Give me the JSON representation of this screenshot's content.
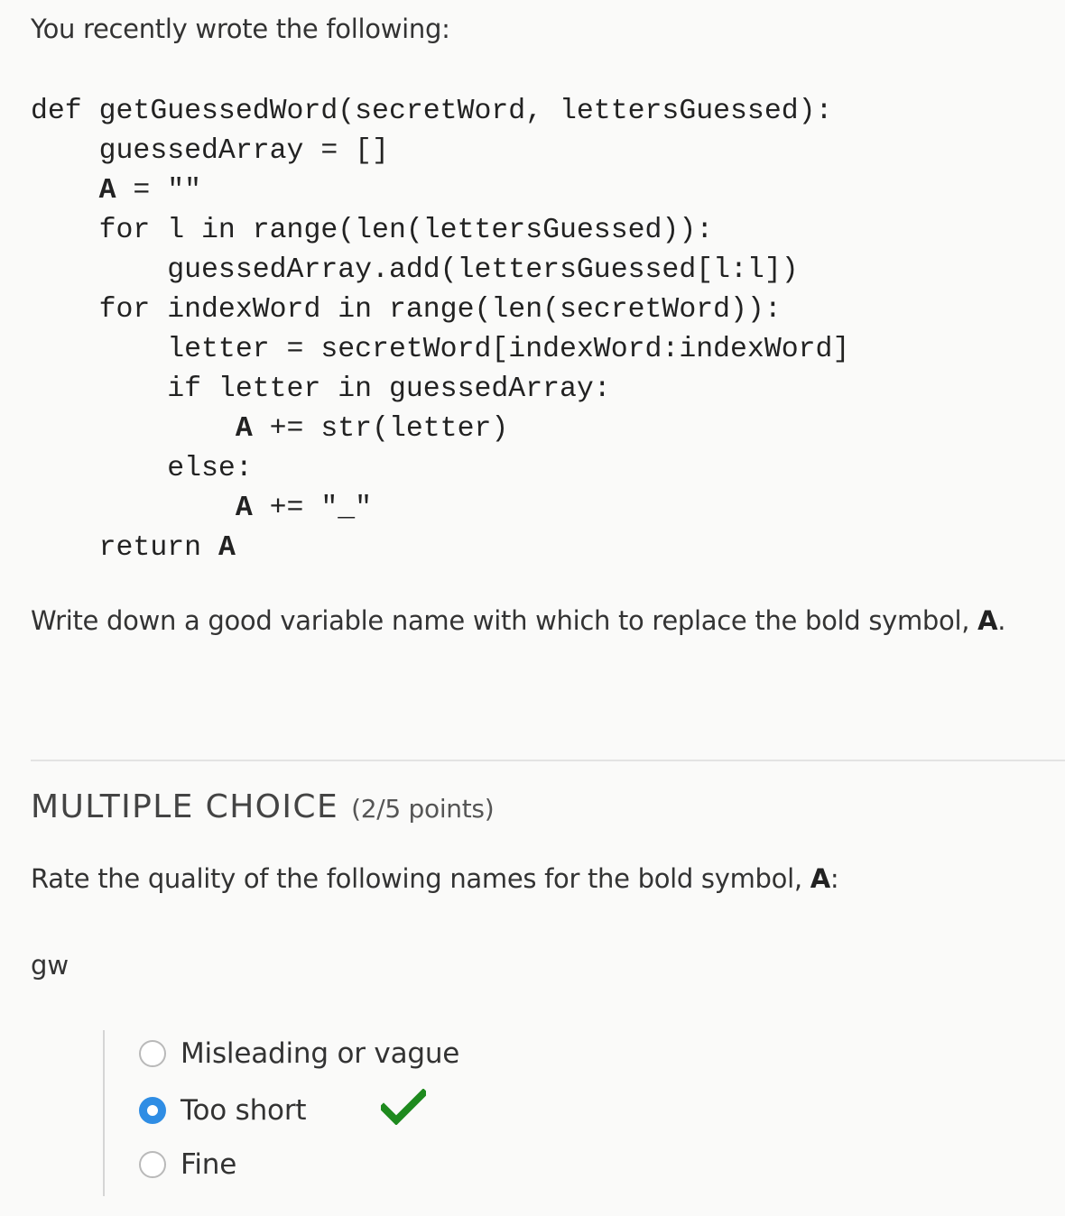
{
  "intro_text": "You recently wrote the following:",
  "code": {
    "line1": "def getGuessedWord(secretWord, lettersGuessed):",
    "line2": "    guessedArray = []",
    "line3_sym": "A",
    "line3_rest": " = \"\"",
    "line4": "    for l in range(len(lettersGuessed)):",
    "line5": "        guessedArray.add(lettersGuessed[l:l])",
    "line6": "    for indexWord in range(len(secretWord)):",
    "line7": "        letter = secretWord[indexWord:indexWord]",
    "line8": "        if letter in guessedArray:",
    "line9_sym": "A",
    "line9_rest": " += str(letter)",
    "line10": "        else:",
    "line11_sym": "A",
    "line11_rest": " += \"_\"",
    "line12_kw": "return ",
    "line12_sym": "A"
  },
  "prompt": {
    "text": "Write down a good variable name with which to replace the bold symbol, ",
    "symbol": "A",
    "end": "."
  },
  "section": {
    "title": "MULTIPLE CHOICE",
    "points": "(2/5 points)"
  },
  "rate": {
    "text": "Rate the quality of the following names for the bold symbol, ",
    "symbol": "A",
    "end": ":"
  },
  "candidate_name": "gw",
  "options": [
    {
      "label": "Misleading or vague",
      "selected": false
    },
    {
      "label": "Too short",
      "selected": true,
      "correct": true
    },
    {
      "label": "Fine",
      "selected": false
    }
  ],
  "colors": {
    "radio_selected": "#2f8de4",
    "correct_check": "#1e8a1e"
  },
  "icons": {
    "correct": "checkmark-icon"
  }
}
